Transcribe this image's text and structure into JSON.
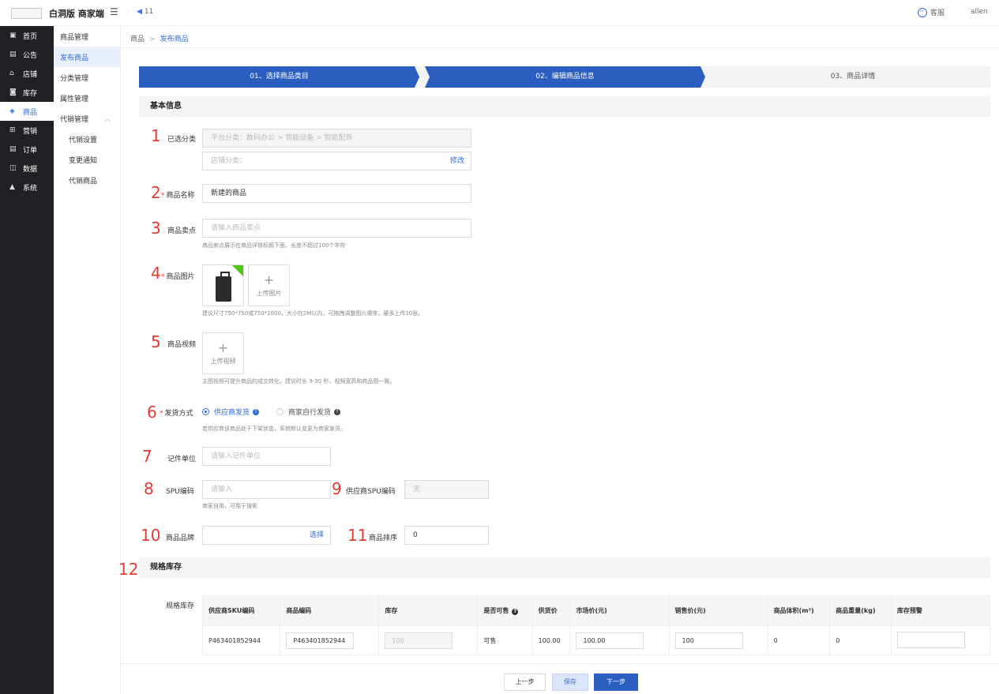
{
  "header": {
    "app_title": "白洞版 商家端",
    "notice_count": "11",
    "service_label": "客服",
    "user_name": "allen"
  },
  "sidebar": {
    "items": [
      {
        "label": "首页",
        "icon": "home-icon"
      },
      {
        "label": "公告",
        "icon": "notice-icon"
      },
      {
        "label": "店铺",
        "icon": "shop-icon"
      },
      {
        "label": "库存",
        "icon": "inventory-icon"
      },
      {
        "label": "商品",
        "icon": "goods-icon"
      },
      {
        "label": "营销",
        "icon": "marketing-icon"
      },
      {
        "label": "订单",
        "icon": "order-icon"
      },
      {
        "label": "数据",
        "icon": "data-icon"
      },
      {
        "label": "系统",
        "icon": "lock-icon"
      }
    ]
  },
  "subnav": {
    "items": [
      "商品管理",
      "发布商品",
      "分类管理",
      "属性管理",
      "代销管理",
      "代销设置",
      "变更通知",
      "代销商品"
    ]
  },
  "breadcrumb": {
    "root": "商品",
    "current": "发布商品"
  },
  "steps": [
    "01、选择商品类目",
    "02、编辑商品信息",
    "03、商品详情"
  ],
  "basic_section": {
    "title": "基本信息"
  },
  "markers": [
    "1",
    "2",
    "3",
    "4",
    "5",
    "6",
    "7",
    "8",
    "9",
    "10",
    "11",
    "12"
  ],
  "form": {
    "category_label": "已选分类",
    "platform_category": "平台分类：数码办公 > 智能设备 > 智能配饰",
    "shop_category": "店铺分类：",
    "modify_link": "修改",
    "name_label": "商品名称",
    "name_value": "新建的商品",
    "selling_label": "商品卖点",
    "selling_placeholder": "请输入商品卖点",
    "selling_hint": "商品卖点展示在商品详情标题下面，长度不超过100个字符",
    "image_label": "商品图片",
    "upload_image": "上传图片",
    "image_hint": "建议尺寸750*750或750*1000，大小在2M以内，可拖拽调整图片顺序，最多上传10张。",
    "video_label": "商品视频",
    "upload_video": "上传视频",
    "video_hint": "主图视频可提升商品的成交转化，建议时长 9-30 秒，视频宽高和商品图一致。",
    "ship_label": "发货方式",
    "ship_option1": "供应商发货",
    "ship_option2": "商家自行发货",
    "ship_hint": "若供应商该商品处于下架状态，系统默认变更为商家发货。",
    "unit_label": "记件单位",
    "unit_placeholder": "请输入记件单位",
    "spu_label": "SPU编码",
    "spu_placeholder": "请输入",
    "spu_hint": "商家自用，可用于搜索",
    "supplier_spu_label": "供应商SPU编码",
    "supplier_spu_value": "无",
    "brand_label": "商品品牌",
    "brand_select": "选择",
    "sort_label": "商品排序",
    "sort_value": "0",
    "plus": "+",
    "question": "?"
  },
  "spec_section": {
    "title": "规格库存",
    "label": "规格库存",
    "headers": [
      "供应商SKU编码",
      "商品编码",
      "库存",
      "是否可售",
      "供货价",
      "市场价(元)",
      "销售价(元)",
      "商品体积(m³)",
      "商品重量(kg)",
      "库存预警"
    ],
    "row": {
      "supplier_sku": "P463401852944",
      "product_code": "P463401852944",
      "stock": "100",
      "saleable": "可售",
      "supply_price": "100.00",
      "market_price": "100.00",
      "sale_price": "100",
      "volume": "0",
      "weight": "0",
      "stock_alert": ""
    }
  },
  "footer": {
    "prev": "上一步",
    "save": "保存",
    "next": "下一步"
  }
}
